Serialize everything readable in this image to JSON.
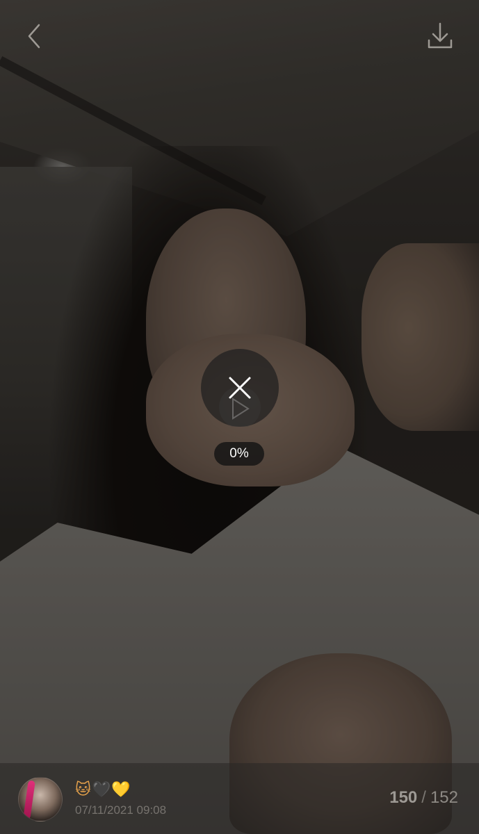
{
  "header": {
    "back_icon": "chevron-left-icon",
    "download_icon": "download-icon"
  },
  "media": {
    "type": "video",
    "state": "loading",
    "progress_label": "0%",
    "progress_percent": 0,
    "play_icon": "play-icon",
    "cancel_icon": "close-icon"
  },
  "footer": {
    "emoji": {
      "cat": "🐱",
      "black_heart": "🖤",
      "yellow_heart": "💛"
    },
    "timestamp": "07/11/2021 09:08",
    "counter": {
      "current": "150",
      "separator": "/",
      "total": "152"
    }
  },
  "colors": {
    "icon": "#9e9a94",
    "overlay_circle": "#1e1e1e",
    "pill_text": "#ffffff",
    "timestamp": "#77736e",
    "counter": "#8e8a85"
  }
}
